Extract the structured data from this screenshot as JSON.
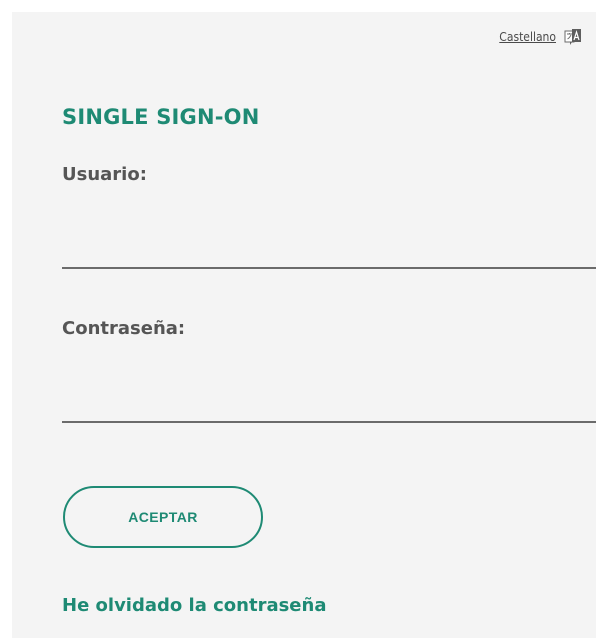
{
  "language": {
    "label": "Castellano",
    "icon": "translate-icon"
  },
  "title": "SINGLE SIGN-ON",
  "form": {
    "username_label": "Usuario:",
    "username_value": "",
    "password_label": "Contraseña:",
    "password_value": "",
    "submit_label": "ACEPTAR"
  },
  "forgot_password_link": "He olvidado la contraseña",
  "colors": {
    "accent": "#1e8a74",
    "panel_background": "#f4f4f4",
    "label_text": "#555555",
    "input_underline": "#6b6b6b"
  }
}
